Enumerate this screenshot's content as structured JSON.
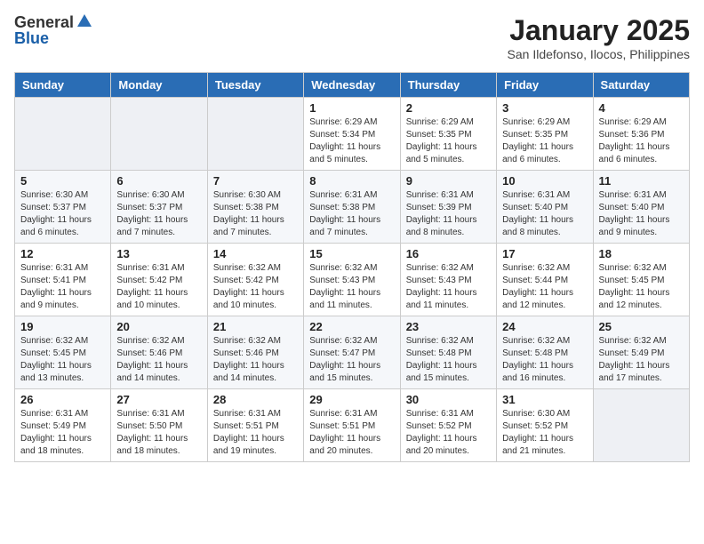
{
  "logo": {
    "general": "General",
    "blue": "Blue"
  },
  "header": {
    "title": "January 2025",
    "subtitle": "San Ildefonso, Ilocos, Philippines"
  },
  "weekdays": [
    "Sunday",
    "Monday",
    "Tuesday",
    "Wednesday",
    "Thursday",
    "Friday",
    "Saturday"
  ],
  "weeks": [
    [
      {
        "day": "",
        "info": ""
      },
      {
        "day": "",
        "info": ""
      },
      {
        "day": "",
        "info": ""
      },
      {
        "day": "1",
        "info": "Sunrise: 6:29 AM\nSunset: 5:34 PM\nDaylight: 11 hours and 5 minutes."
      },
      {
        "day": "2",
        "info": "Sunrise: 6:29 AM\nSunset: 5:35 PM\nDaylight: 11 hours and 5 minutes."
      },
      {
        "day": "3",
        "info": "Sunrise: 6:29 AM\nSunset: 5:35 PM\nDaylight: 11 hours and 6 minutes."
      },
      {
        "day": "4",
        "info": "Sunrise: 6:29 AM\nSunset: 5:36 PM\nDaylight: 11 hours and 6 minutes."
      }
    ],
    [
      {
        "day": "5",
        "info": "Sunrise: 6:30 AM\nSunset: 5:37 PM\nDaylight: 11 hours and 6 minutes."
      },
      {
        "day": "6",
        "info": "Sunrise: 6:30 AM\nSunset: 5:37 PM\nDaylight: 11 hours and 7 minutes."
      },
      {
        "day": "7",
        "info": "Sunrise: 6:30 AM\nSunset: 5:38 PM\nDaylight: 11 hours and 7 minutes."
      },
      {
        "day": "8",
        "info": "Sunrise: 6:31 AM\nSunset: 5:38 PM\nDaylight: 11 hours and 7 minutes."
      },
      {
        "day": "9",
        "info": "Sunrise: 6:31 AM\nSunset: 5:39 PM\nDaylight: 11 hours and 8 minutes."
      },
      {
        "day": "10",
        "info": "Sunrise: 6:31 AM\nSunset: 5:40 PM\nDaylight: 11 hours and 8 minutes."
      },
      {
        "day": "11",
        "info": "Sunrise: 6:31 AM\nSunset: 5:40 PM\nDaylight: 11 hours and 9 minutes."
      }
    ],
    [
      {
        "day": "12",
        "info": "Sunrise: 6:31 AM\nSunset: 5:41 PM\nDaylight: 11 hours and 9 minutes."
      },
      {
        "day": "13",
        "info": "Sunrise: 6:31 AM\nSunset: 5:42 PM\nDaylight: 11 hours and 10 minutes."
      },
      {
        "day": "14",
        "info": "Sunrise: 6:32 AM\nSunset: 5:42 PM\nDaylight: 11 hours and 10 minutes."
      },
      {
        "day": "15",
        "info": "Sunrise: 6:32 AM\nSunset: 5:43 PM\nDaylight: 11 hours and 11 minutes."
      },
      {
        "day": "16",
        "info": "Sunrise: 6:32 AM\nSunset: 5:43 PM\nDaylight: 11 hours and 11 minutes."
      },
      {
        "day": "17",
        "info": "Sunrise: 6:32 AM\nSunset: 5:44 PM\nDaylight: 11 hours and 12 minutes."
      },
      {
        "day": "18",
        "info": "Sunrise: 6:32 AM\nSunset: 5:45 PM\nDaylight: 11 hours and 12 minutes."
      }
    ],
    [
      {
        "day": "19",
        "info": "Sunrise: 6:32 AM\nSunset: 5:45 PM\nDaylight: 11 hours and 13 minutes."
      },
      {
        "day": "20",
        "info": "Sunrise: 6:32 AM\nSunset: 5:46 PM\nDaylight: 11 hours and 14 minutes."
      },
      {
        "day": "21",
        "info": "Sunrise: 6:32 AM\nSunset: 5:46 PM\nDaylight: 11 hours and 14 minutes."
      },
      {
        "day": "22",
        "info": "Sunrise: 6:32 AM\nSunset: 5:47 PM\nDaylight: 11 hours and 15 minutes."
      },
      {
        "day": "23",
        "info": "Sunrise: 6:32 AM\nSunset: 5:48 PM\nDaylight: 11 hours and 15 minutes."
      },
      {
        "day": "24",
        "info": "Sunrise: 6:32 AM\nSunset: 5:48 PM\nDaylight: 11 hours and 16 minutes."
      },
      {
        "day": "25",
        "info": "Sunrise: 6:32 AM\nSunset: 5:49 PM\nDaylight: 11 hours and 17 minutes."
      }
    ],
    [
      {
        "day": "26",
        "info": "Sunrise: 6:31 AM\nSunset: 5:49 PM\nDaylight: 11 hours and 18 minutes."
      },
      {
        "day": "27",
        "info": "Sunrise: 6:31 AM\nSunset: 5:50 PM\nDaylight: 11 hours and 18 minutes."
      },
      {
        "day": "28",
        "info": "Sunrise: 6:31 AM\nSunset: 5:51 PM\nDaylight: 11 hours and 19 minutes."
      },
      {
        "day": "29",
        "info": "Sunrise: 6:31 AM\nSunset: 5:51 PM\nDaylight: 11 hours and 20 minutes."
      },
      {
        "day": "30",
        "info": "Sunrise: 6:31 AM\nSunset: 5:52 PM\nDaylight: 11 hours and 20 minutes."
      },
      {
        "day": "31",
        "info": "Sunrise: 6:30 AM\nSunset: 5:52 PM\nDaylight: 11 hours and 21 minutes."
      },
      {
        "day": "",
        "info": ""
      }
    ]
  ]
}
